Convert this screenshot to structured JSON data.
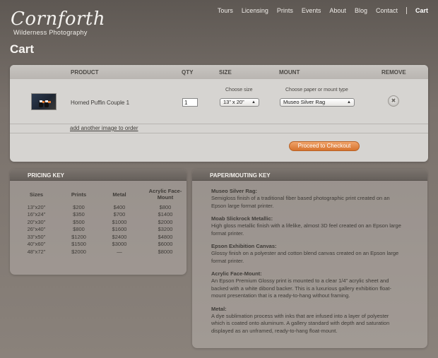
{
  "logo": {
    "script": "Cornforth",
    "subtitle": "Wilderness Photography"
  },
  "nav": {
    "items": [
      "Tours",
      "Licensing",
      "Prints",
      "Events",
      "About",
      "Blog",
      "Contact"
    ],
    "cart": "Cart"
  },
  "page_title": "Cart",
  "cart": {
    "headers": {
      "product": "PRODUCT",
      "qty": "QTY",
      "size": "SIZE",
      "mount": "MOUNT",
      "remove": "REMOVE"
    },
    "item": {
      "name": "Horned Puffin Couple 1",
      "qty": "1",
      "size_label": "Choose size",
      "size_value": "13” x 20”",
      "mount_label": "Choose paper or mount type",
      "mount_value": "Museo Silver Rag"
    },
    "add_link": "add another image to order",
    "checkout_label": "Proceed to Checkout"
  },
  "pricing_key": {
    "title": "PRICING KEY",
    "columns": [
      "Sizes",
      "Prints",
      "Metal",
      "Acrylic Face-Mount"
    ],
    "rows": [
      [
        "13\"x20\"",
        "$200",
        "$400",
        "$800"
      ],
      [
        "16\"x24\"",
        "$350",
        "$700",
        "$1400"
      ],
      [
        "20\"x30\"",
        "$500",
        "$1000",
        "$2000"
      ],
      [
        "26\"x40\"",
        "$800",
        "$1600",
        "$3200"
      ],
      [
        "33\"x50\"",
        "$1200",
        "$2400",
        "$4800"
      ],
      [
        "40\"x60\"",
        "$1500",
        "$3000",
        "$6000"
      ],
      [
        "48\"x72\"",
        "$2000",
        "—",
        "$8000"
      ]
    ]
  },
  "paper_key": {
    "title": "PAPER/MOUTING KEY",
    "items": [
      {
        "title": "Museo Silver Rag:",
        "desc": "Semigloss finish of a traditional fiber based photographic print created on an Epson large format printer."
      },
      {
        "title": "Moab Slickrock Metallic:",
        "desc": "High gloss metallic finish with a lifelike, almost 3D feel created on an Epson large format printer."
      },
      {
        "title": "Epson Exhibition Canvas:",
        "desc": "Glossy finish on a polyester and cotton blend canvas created on an Epson large format printer."
      },
      {
        "title": "Acrylic Face-Mount:",
        "desc": "An Epson Premium Glossy print is mounted to a clear 1/4” acrylic sheet and backed with a white dibond backer. This is a luxurious gallery exhibition float-mount presentation that is a ready-to-hang without framing."
      },
      {
        "title": "Metal:",
        "desc": "A dye sublimation process with inks that are infused into a layer of polyester which is coated onto aluminum. A gallery standard with depth and saturation displayed as an unframed, ready-to-hang float-mount."
      }
    ]
  },
  "colors": {
    "accent": "#d6732e",
    "panel": "#d6d4d1",
    "background": "#7a726c"
  }
}
